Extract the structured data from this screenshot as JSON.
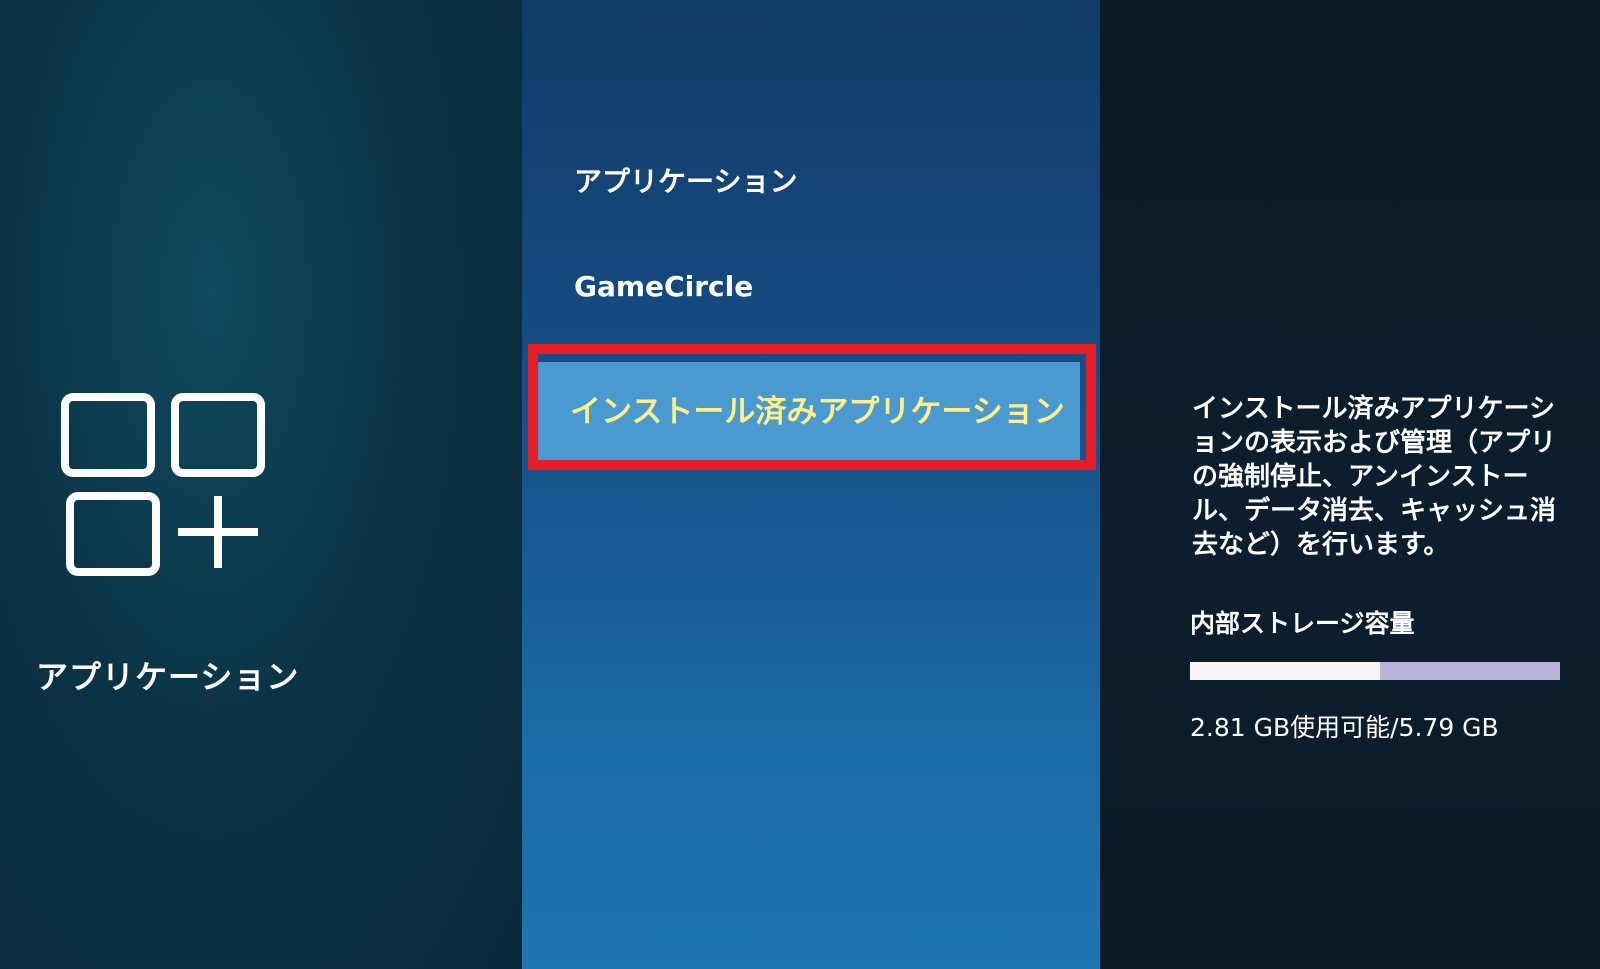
{
  "category": {
    "title": "アプリケーション",
    "icon": "apps-grid-plus-icon"
  },
  "menu": {
    "items": [
      {
        "label": "アプリケーション"
      },
      {
        "label": "GameCircle"
      },
      {
        "label": "インストール済みアプリケーション",
        "selected": true
      }
    ]
  },
  "info": {
    "description": "インストール済みアプリケーションの表示および管理（アプリの強制停止、アンインストール、データ消去、キャッシュ消去など）を行います。",
    "storage": {
      "heading": "内部ストレージ容量",
      "usage_text": "2.81 GB使用可能/5.79 GB",
      "available_gb": 2.81,
      "total_gb": 5.79
    }
  },
  "colors": {
    "highlight_frame": "#e41d28",
    "selected_text": "#ffef8a",
    "selected_bg": "#4a9ad0"
  }
}
